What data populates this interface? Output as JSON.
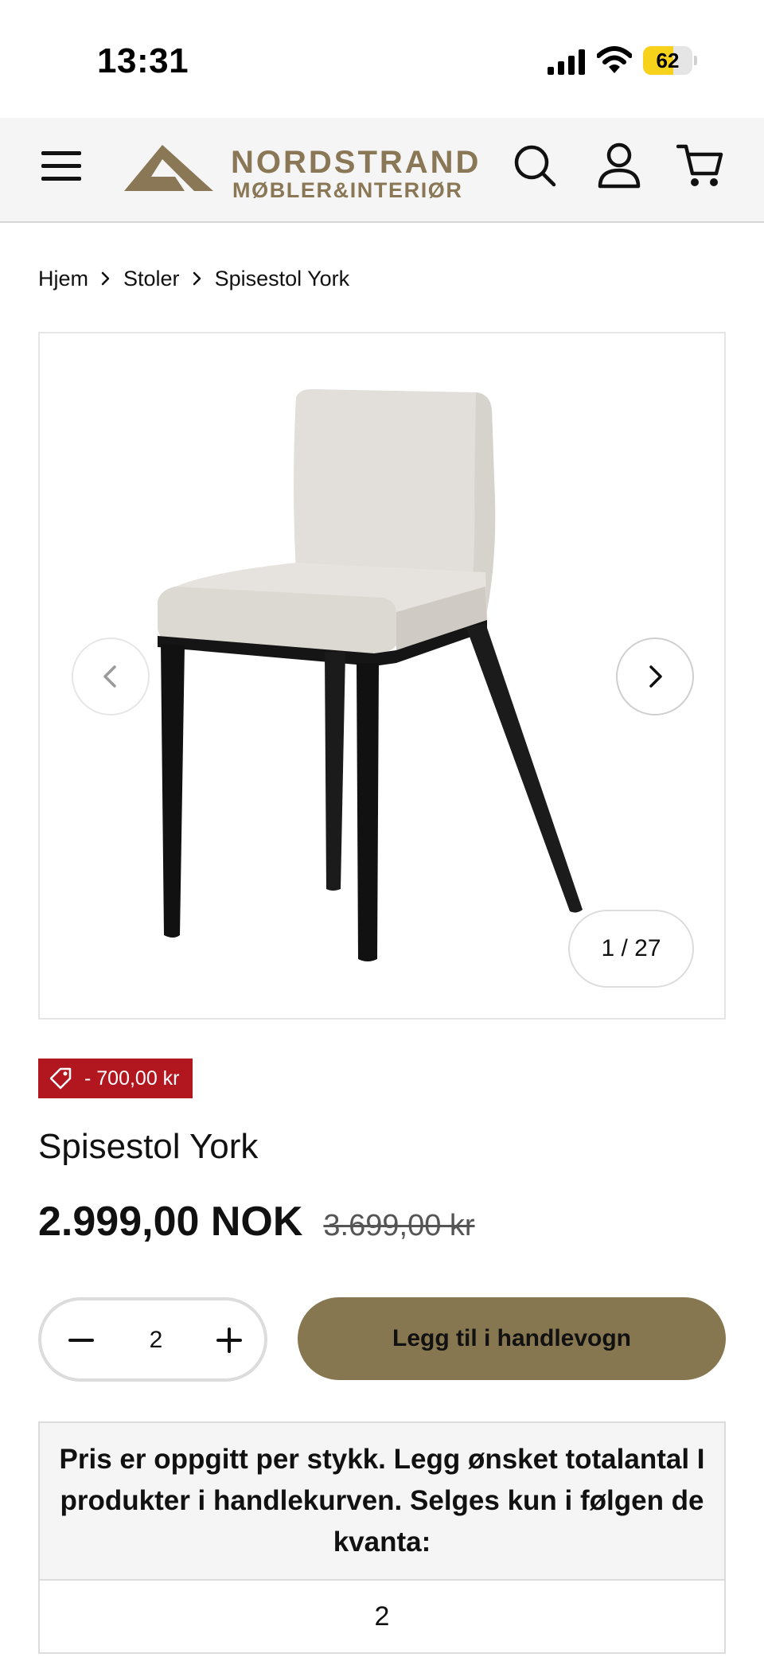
{
  "status_bar": {
    "time": "13:31",
    "battery_level": "62",
    "battery_fraction": 0.62,
    "icons": [
      "cellular-signal-icon",
      "wifi-icon",
      "battery-icon"
    ]
  },
  "header": {
    "logo_title": "NORDSTRAND",
    "logo_subtitle": "MØBLER&INTERIØR",
    "brand_color": "#897755",
    "icons": [
      "menu-icon",
      "search-icon",
      "account-icon",
      "cart-icon"
    ]
  },
  "breadcrumb": {
    "items": [
      "Hjem",
      "Stoler",
      "Spisestol York"
    ]
  },
  "gallery": {
    "counter": "1 / 27",
    "current_image": 1,
    "total_images": 27
  },
  "product": {
    "discount_badge": "- 700,00 kr",
    "badge_color": "#b2161f",
    "title": "Spisestol York",
    "price": "2.999,00 NOK",
    "old_price": "3.699,00 kr"
  },
  "purchase": {
    "quantity": "2",
    "add_to_cart_label": "Legg til i handlevogn",
    "button_color": "#867750"
  },
  "info_table": {
    "header": "Pris er oppgitt per stykk. Legg ønsket totalantal I produkter i handlekurven. Selges kun i følgen de kvanta:",
    "value": "2"
  }
}
